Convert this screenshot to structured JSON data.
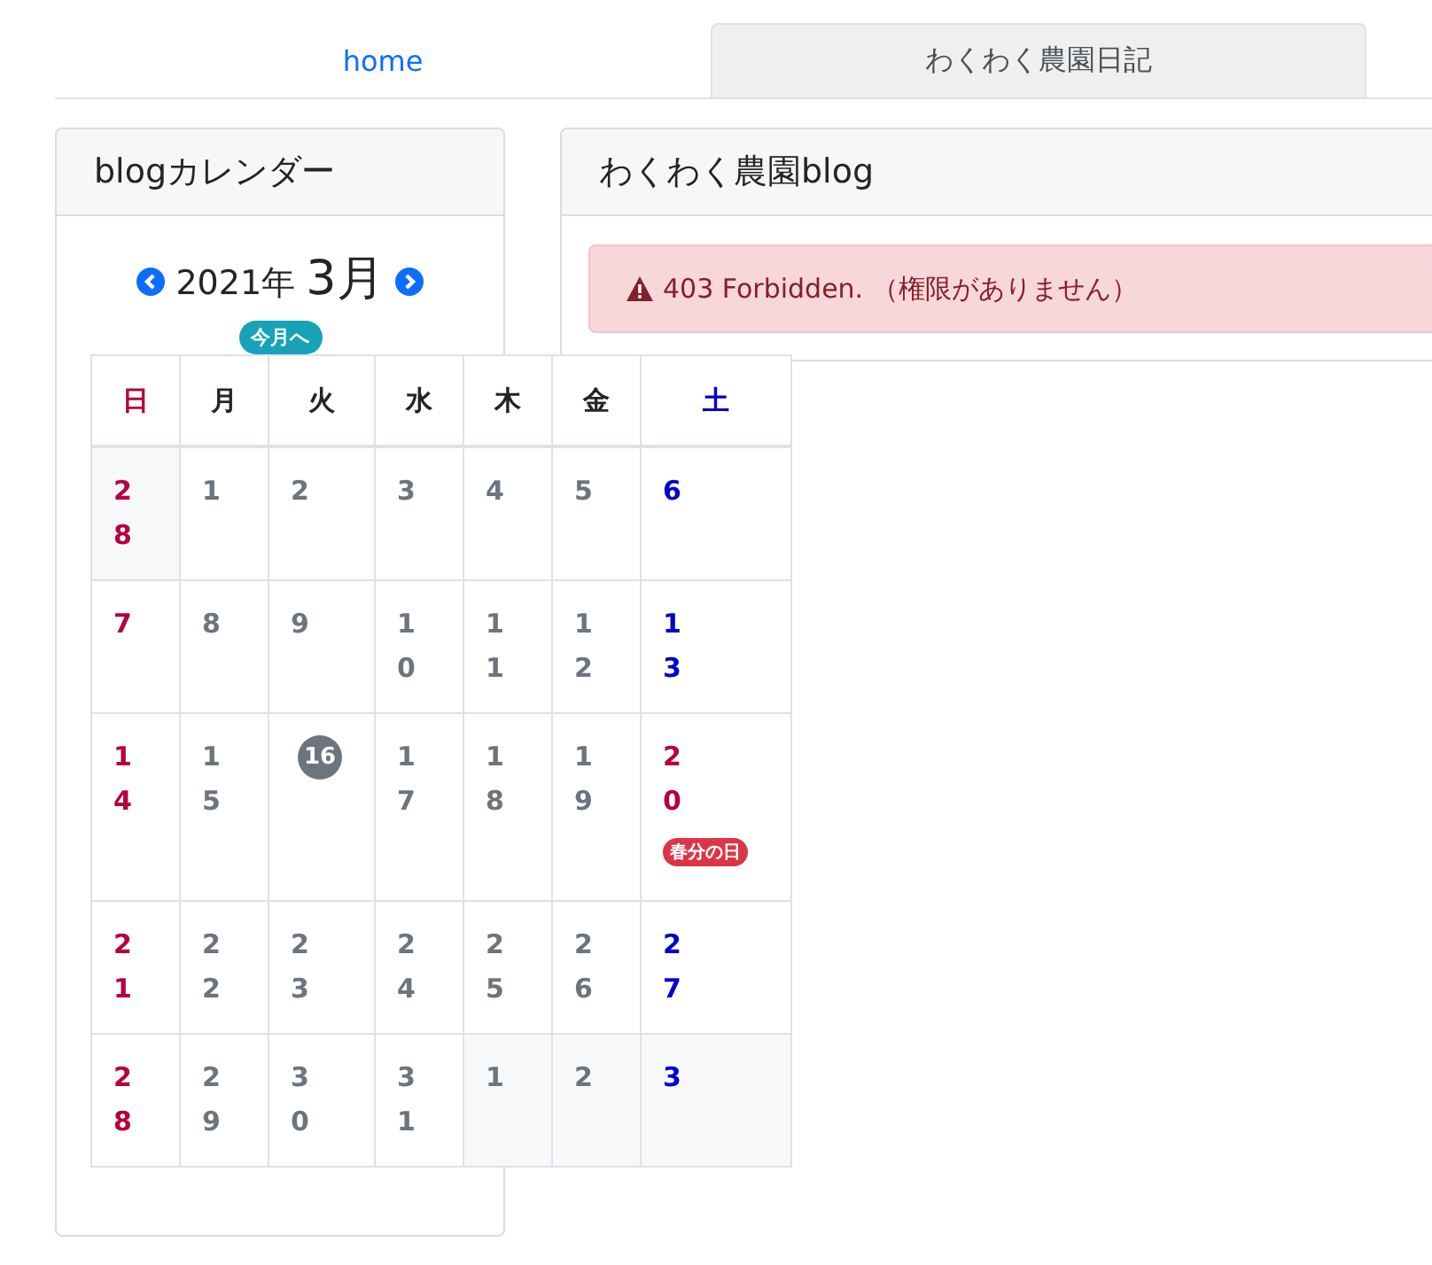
{
  "tabs": [
    {
      "label": "home",
      "selected": false
    },
    {
      "label": "わくわく農園日記",
      "selected": true
    }
  ],
  "calendar_card": {
    "title": "blogカレンダー",
    "year": "2021年",
    "month": "3月",
    "today_button": "今月へ",
    "weekdays": [
      {
        "label": "日",
        "kind": "sun"
      },
      {
        "label": "月",
        "kind": "weekday"
      },
      {
        "label": "火",
        "kind": "weekday"
      },
      {
        "label": "水",
        "kind": "weekday"
      },
      {
        "label": "木",
        "kind": "weekday"
      },
      {
        "label": "金",
        "kind": "weekday"
      },
      {
        "label": "土",
        "kind": "sat"
      }
    ],
    "weeks": [
      [
        {
          "label": "28",
          "kind": "sun",
          "outside": true,
          "today": false
        },
        {
          "label": "1",
          "kind": "weekday",
          "outside": false,
          "today": false
        },
        {
          "label": "2",
          "kind": "weekday",
          "outside": false,
          "today": false
        },
        {
          "label": "3",
          "kind": "weekday",
          "outside": false,
          "today": false
        },
        {
          "label": "4",
          "kind": "weekday",
          "outside": false,
          "today": false
        },
        {
          "label": "5",
          "kind": "weekday",
          "outside": false,
          "today": false
        },
        {
          "label": "6",
          "kind": "sat",
          "outside": false,
          "today": false
        }
      ],
      [
        {
          "label": "7",
          "kind": "sun",
          "outside": false,
          "today": false
        },
        {
          "label": "8",
          "kind": "weekday",
          "outside": false,
          "today": false
        },
        {
          "label": "9",
          "kind": "weekday",
          "outside": false,
          "today": false
        },
        {
          "label": "10",
          "kind": "weekday",
          "outside": false,
          "today": false
        },
        {
          "label": "11",
          "kind": "weekday",
          "outside": false,
          "today": false
        },
        {
          "label": "12",
          "kind": "weekday",
          "outside": false,
          "today": false
        },
        {
          "label": "13",
          "kind": "sat",
          "outside": false,
          "today": false
        }
      ],
      [
        {
          "label": "14",
          "kind": "sun",
          "outside": false,
          "today": false
        },
        {
          "label": "15",
          "kind": "weekday",
          "outside": false,
          "today": false
        },
        {
          "label": "16",
          "kind": "weekday",
          "outside": false,
          "today": true
        },
        {
          "label": "17",
          "kind": "weekday",
          "outside": false,
          "today": false
        },
        {
          "label": "18",
          "kind": "weekday",
          "outside": false,
          "today": false
        },
        {
          "label": "19",
          "kind": "weekday",
          "outside": false,
          "today": false
        },
        {
          "label": "20",
          "kind": "sun",
          "outside": false,
          "today": false,
          "holiday": "春分の日"
        }
      ],
      [
        {
          "label": "21",
          "kind": "sun",
          "outside": false,
          "today": false
        },
        {
          "label": "22",
          "kind": "weekday",
          "outside": false,
          "today": false
        },
        {
          "label": "23",
          "kind": "weekday",
          "outside": false,
          "today": false
        },
        {
          "label": "24",
          "kind": "weekday",
          "outside": false,
          "today": false
        },
        {
          "label": "25",
          "kind": "weekday",
          "outside": false,
          "today": false
        },
        {
          "label": "26",
          "kind": "weekday",
          "outside": false,
          "today": false
        },
        {
          "label": "27",
          "kind": "sat",
          "outside": false,
          "today": false
        }
      ],
      [
        {
          "label": "28",
          "kind": "sun",
          "outside": false,
          "today": false
        },
        {
          "label": "29",
          "kind": "weekday",
          "outside": false,
          "today": false
        },
        {
          "label": "30",
          "kind": "weekday",
          "outside": false,
          "today": false
        },
        {
          "label": "31",
          "kind": "weekday",
          "outside": false,
          "today": false
        },
        {
          "label": "1",
          "kind": "weekday",
          "outside": true,
          "today": false
        },
        {
          "label": "2",
          "kind": "weekday",
          "outside": true,
          "today": false
        },
        {
          "label": "3",
          "kind": "sat",
          "outside": true,
          "today": false
        }
      ]
    ]
  },
  "blog_card": {
    "title": "わくわく農園blog",
    "alert": "403 Forbidden. （権限がありません）"
  }
}
